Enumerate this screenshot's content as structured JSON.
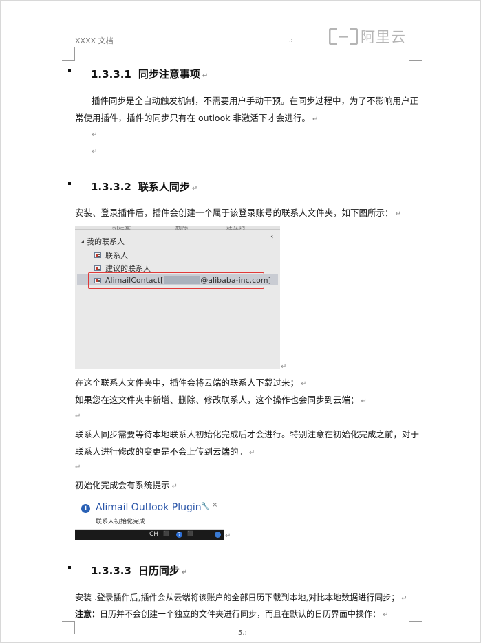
{
  "header": {
    "doc_label": "XXXX 文档",
    "mark": ".:",
    "logo_text": "阿里云"
  },
  "sections": [
    {
      "number": "1.3.3.1",
      "title": "同步注意事项"
    },
    {
      "number": "1.3.3.2",
      "title": "联系人同步"
    },
    {
      "number": "1.3.3.3",
      "title": "日历同步"
    }
  ],
  "paragraphs": {
    "p1_line1": "插件同步是全自动触发机制，不需要用户手动干预。在同步过程中，为了不影响用户正",
    "p1_line2": "常使用插件，插件的同步只有在 outlook 非激活下才会进行。",
    "p2": "安装、登录插件后，插件会创建一个属于该登录账号的联系人文件夹，如下图所示：",
    "p3": "在这个联系人文件夹中，插件会将云端的联系人下载过来；",
    "p4": "如果您在这文件夹中新增、删除、修改联系人，这个操作也会同步到云端；",
    "p5_line1": "联系人同步需要等待本地联系人初始化完成后才会进行。特别注意在初始化完成之前，对于",
    "p5_line2": "联系人进行修改的变更是不会上传到云端的。",
    "p6": "初始化完成会有系统提示",
    "p7": "安装 .登录插件后,插件会从云端将该账户的全部日历下载到本地,对比本地数据进行同步；",
    "p8_label": "注意：",
    "p8_text": "日历并不会创建一个独立的文件夹进行同步，而且在默认的日历界面中操作："
  },
  "para_mark": "↵",
  "contacts_panel": {
    "tabs": [
      "新建查",
      "删除",
      "建立词"
    ],
    "collapse_glyph": "‹",
    "root": "我的联系人",
    "items": [
      "联系人",
      "建议的联系人"
    ],
    "selected_prefix": "AlimailContact[",
    "selected_suffix": "@alibaba-inc.com]"
  },
  "notification": {
    "title": "Alimail Outlook Plugin",
    "message": "联系人初始化完成",
    "info_glyph": "i",
    "pin_glyph": "🔧",
    "close_glyph": "×",
    "tray": [
      "CH",
      "⬛",
      "?",
      "⬛"
    ]
  },
  "footer": {
    "page": "5.:"
  },
  "colors": {
    "highlight_box": "#e03a3a",
    "notification_title": "#2a55a8",
    "logo": "#b5b5b5"
  }
}
